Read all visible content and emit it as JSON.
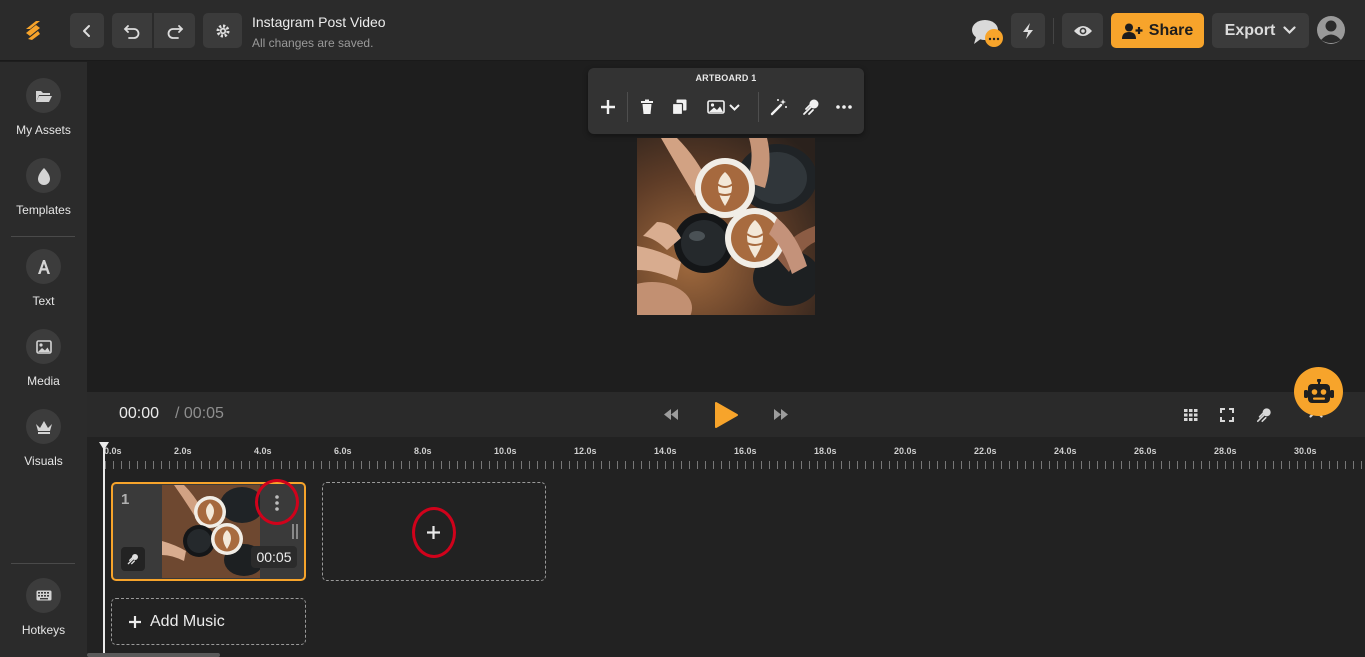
{
  "header": {
    "title": "Instagram Post Video",
    "subtitle": "All changes are saved.",
    "share_label": "Share",
    "export_label": "Export",
    "accent": "#f7a42b"
  },
  "sidebar": {
    "items": [
      {
        "label": "My Assets",
        "icon": "folder-open-icon"
      },
      {
        "label": "Templates",
        "icon": "templates-icon"
      },
      {
        "label": "Text",
        "icon": "text-icon"
      },
      {
        "label": "Media",
        "icon": "image-icon"
      },
      {
        "label": "Visuals",
        "icon": "crown-icon"
      },
      {
        "label": "Hotkeys",
        "icon": "keyboard-icon"
      }
    ]
  },
  "artboard": {
    "label": "ARTBOARD 1"
  },
  "playback": {
    "current_time": "00:00",
    "total_time": "/ 00:05"
  },
  "timeline": {
    "ruler": [
      "0.0s",
      "2.0s",
      "4.0s",
      "6.0s",
      "8.0s",
      "10.0s",
      "12.0s",
      "14.0s",
      "16.0s",
      "18.0s",
      "20.0s",
      "22.0s",
      "24.0s",
      "26.0s",
      "28.0s",
      "30.0s"
    ],
    "clips": [
      {
        "number": "1",
        "duration": "00:05"
      }
    ],
    "add_music_label": "Add Music"
  }
}
